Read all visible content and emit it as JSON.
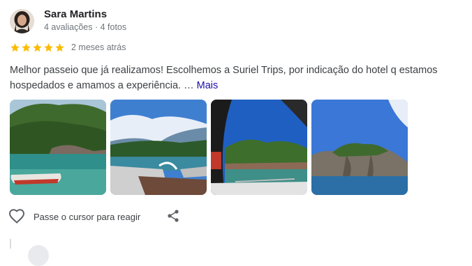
{
  "reviewer": {
    "name": "Sara Martins",
    "meta": "4 avaliações · 4 fotos",
    "avatar_icon": "profile-photo"
  },
  "rating": {
    "stars": 5,
    "max_stars": 5,
    "date": "2 meses atrás",
    "star_color": "#fbbc04"
  },
  "review": {
    "text": "Melhor passeio que já realizamos! Escolhemos a Suriel Trips, por indicação do hotel q estamos hospedados e amamos a experiência. …",
    "more_label": "Mais",
    "link_color": "#1a0dab"
  },
  "photos": [
    {
      "subject": "boat-on-beach"
    },
    {
      "subject": "boat-deck-water"
    },
    {
      "subject": "boat-cabin-island"
    },
    {
      "subject": "rock-island"
    }
  ],
  "actions": {
    "react_label": "Passe o cursor para reagir",
    "like_icon": "heart-outline-icon",
    "share_icon": "share-icon"
  }
}
